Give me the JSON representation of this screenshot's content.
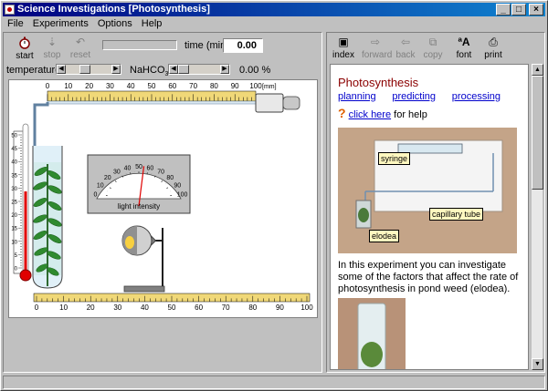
{
  "window": {
    "title": "Science Investigations [Photosynthesis]",
    "controls": {
      "minimize": "_",
      "maximize": "□",
      "close": "×"
    }
  },
  "menu": [
    "File",
    "Experiments",
    "Options",
    "Help"
  ],
  "sim_toolbar": {
    "start": "start",
    "stop": "stop",
    "reset": "reset",
    "time_label": "time (min)",
    "time_value": "0.00",
    "icons": {
      "start": "stopwatch-icon",
      "stop": "down-arrow-icon",
      "reset": "undo-arrow-icon"
    }
  },
  "controls_row": {
    "temperature_label": "temperature",
    "nahco3_label": "NaHCO",
    "nahco3_sub": "3",
    "nahco3_value": "0.00 %",
    "temperature_level": 0.4,
    "nahco3_level": 0.0
  },
  "capillary_scale": {
    "ticks": [
      "0",
      "10",
      "20",
      "30",
      "40",
      "50",
      "60",
      "70",
      "80",
      "90",
      "100"
    ],
    "unit": "[mm]"
  },
  "thermometer_scale": {
    "ticks": [
      "50",
      "45",
      "40",
      "35",
      "30",
      "25",
      "20",
      "15",
      "10",
      "5",
      "0"
    ]
  },
  "meter": {
    "label": "light intensity",
    "ticks": [
      "0",
      "10",
      "20",
      "30",
      "40",
      "50",
      "60",
      "70",
      "80",
      "90",
      "100"
    ],
    "needle_value": 55
  },
  "distance_scale": {
    "ticks": [
      "0",
      "10",
      "20",
      "30",
      "40",
      "50",
      "60",
      "70",
      "80",
      "90",
      "100"
    ]
  },
  "right_toolbar": {
    "buttons": [
      {
        "label": "index",
        "icon": "book-icon",
        "enabled": true
      },
      {
        "label": "forward",
        "icon": "forward-arrow-icon",
        "enabled": false
      },
      {
        "label": "back",
        "icon": "back-arrow-icon",
        "enabled": false
      },
      {
        "label": "copy",
        "icon": "copy-icon",
        "enabled": false
      },
      {
        "label": "font",
        "icon": "font-icon",
        "enabled": true
      },
      {
        "label": "print",
        "icon": "printer-icon",
        "enabled": true
      }
    ]
  },
  "content": {
    "title": "Photosynthesis",
    "links": [
      "planning",
      "predicting",
      "processing"
    ],
    "help_link": "click here",
    "help_rest": " for help",
    "callouts": {
      "syringe": "syringe",
      "capillary": "capillary tube",
      "elodea": "elodea"
    },
    "paragraph": "In this experiment you can investigate some of the factors that affect the rate of photosynthesis in pond weed (elodea)."
  },
  "colors": {
    "accent": "#8b0000",
    "link": "#0000cc",
    "title_bar": "#000080"
  }
}
